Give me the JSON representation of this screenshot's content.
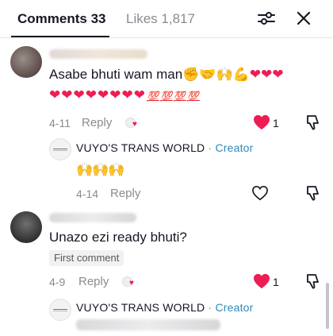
{
  "header": {
    "comments_tab": "Comments 33",
    "likes_tab": "Likes 1,817",
    "filter_icon": "sliders-icon",
    "close_icon": "close-icon"
  },
  "comments": [
    {
      "text_line1": "Asabe bhuti wam man",
      "line1_emojis": [
        "✊",
        "🤝",
        "🙌",
        "💪",
        "❤",
        "❤",
        "❤"
      ],
      "text_line2_hearts": [
        "❤",
        "❤",
        "❤",
        "❤",
        "❤",
        "❤",
        "❤",
        "❤"
      ],
      "text_line2_hundreds": [
        "💯",
        "💯",
        "💯",
        "💯"
      ],
      "date": "4-11",
      "reply_label": "Reply",
      "like_count": "1",
      "liked": true,
      "creator_liked": true,
      "creator_reply": {
        "name": "VUYO'S TRANS WORLD",
        "dot": "·",
        "badge": "Creator",
        "text": "🙌🙌🙌",
        "date": "4-14",
        "reply_label": "Reply",
        "liked": false
      }
    },
    {
      "text": "Unazo ezi ready bhuti?",
      "tag": "First comment",
      "date": "4-9",
      "reply_label": "Reply",
      "like_count": "1",
      "liked": true,
      "creator_liked": true,
      "creator_reply": {
        "name": "VUYO'S TRANS WORLD",
        "dot": "·",
        "badge": "Creator"
      }
    }
  ],
  "colors": {
    "like_red": "#ee1d52",
    "creator_badge": "#2a8bb8",
    "muted_text": "#8a8b91"
  }
}
